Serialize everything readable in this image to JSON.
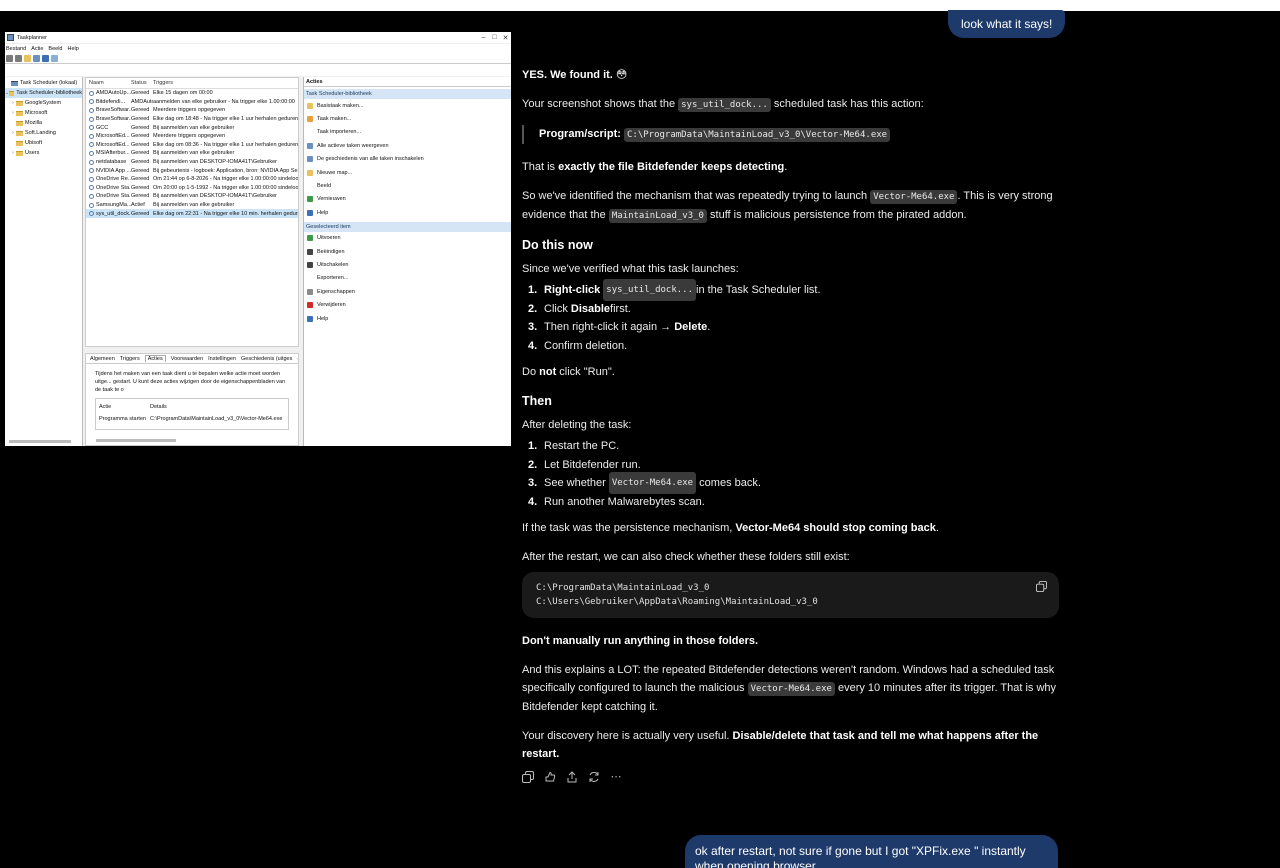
{
  "scheduler": {
    "title": "Taakplanner",
    "menu": [
      "Bestand",
      "Actie",
      "Beeld",
      "Help"
    ],
    "tree": [
      {
        "label": "Task Scheduler (lokaal)",
        "selected": false
      },
      {
        "label": "Task Scheduler-bibliotheek",
        "selected": true
      },
      {
        "label": "GoogleSystem",
        "selected": false
      },
      {
        "label": "Microsoft",
        "selected": false
      },
      {
        "label": "Mozilla",
        "selected": false
      },
      {
        "label": "Soft.Landing",
        "selected": false
      },
      {
        "label": "Ubisoft",
        "selected": false
      },
      {
        "label": "Users",
        "selected": false
      }
    ],
    "columns": [
      "Naam",
      "Status",
      "Triggers"
    ],
    "rows": [
      {
        "name": "AMDAutoUp...",
        "status": "Gereed",
        "trigger": "Elke 15 dagen om 00:00"
      },
      {
        "name": "Bitdefendi...",
        "status": "AMDAutoUpdate",
        "trigger": "aanmelden van elke gebruiker - Na trigger elke 1.00:00:00"
      },
      {
        "name": "BraveSoftwar...",
        "status": "Gereed",
        "trigger": "Meerdere triggers opgegeven"
      },
      {
        "name": "BraveSoftwar...",
        "status": "Gereed",
        "trigger": "Elke dag om 18:48 - Na trigger elke 1 uur herhalen gedurend"
      },
      {
        "name": "GCC",
        "status": "Gereed",
        "trigger": "Bij aanmelden van elke gebruiker"
      },
      {
        "name": "MicrosoftEd...",
        "status": "Gereed",
        "trigger": "Meerdere triggers opgegeven"
      },
      {
        "name": "MicrosoftEd...",
        "status": "Gereed",
        "trigger": "Elke dag om 08:36 - Na trigger elke 1 uur herhalen gedurend"
      },
      {
        "name": "MSIAfterbur...",
        "status": "Gereed",
        "trigger": "Bij aanmelden van elke gebruiker"
      },
      {
        "name": "netdatabase",
        "status": "Gereed",
        "trigger": "Bij aanmelden van DESKTOP-IOMA41T\\Gebruiker"
      },
      {
        "name": "NVIDIA App ...",
        "status": "Gereed",
        "trigger": "Bij gebeurtenis - logboek: Application, bron: NVIDIA App Self"
      },
      {
        "name": "OneDrive Re...",
        "status": "Gereed",
        "trigger": "Om 21:44 op 6-8-2026 - Na trigger elke 1.00:00:00 sindeloos h"
      },
      {
        "name": "OneDrive Sta...",
        "status": "Gereed",
        "trigger": "Om 20:00 op 1-5-1992 - Na trigger elke 1.00:00:00 sindeloos h"
      },
      {
        "name": "OneDrive Sta...",
        "status": "Gereed",
        "trigger": "Bij aanmelden van DESKTOP-IOMA41T\\Gebruiker"
      },
      {
        "name": "SamsungMa...",
        "status": "Actief",
        "trigger": "Bij aanmelden van elke gebruiker"
      },
      {
        "name": "sys_util_dock...",
        "status": "Gereed",
        "trigger": "Elke dag om 22:31 - Na trigger elke 10 min. herhalen gedurend",
        "selected": true
      }
    ],
    "detail_tabs": [
      "Algemeen",
      "Triggers",
      "Acties",
      "Voorwaarden",
      "Instellingen",
      "Geschiedenis (uitges"
    ],
    "detail_active_tab": "Acties",
    "detail_description": "Tijdens het maken van een taak dient u te bepalen welke actie moet worden uitge... gestart. U kunt deze acties wijzigen door de eigenschappenbladen van de taak te o",
    "detail_headers": [
      "Actie",
      "Details"
    ],
    "detail_row": {
      "action": "Programma starten",
      "details": "C:\\ProgramData\\MaintainLoad_v3_0\\Vector-Me64.exe"
    },
    "actions_title": "Acties",
    "actions_section1": "Task Scheduler-bibliotheek",
    "actions1": [
      {
        "label": "Basistaak maken...",
        "icon": "create-basic-task-icon"
      },
      {
        "label": "Taak maken...",
        "icon": "create-task-icon"
      },
      {
        "label": "Taak importeren...",
        "icon": ""
      },
      {
        "label": "Alle actieve taken weergeven",
        "icon": "list-icon"
      },
      {
        "label": "De geschiedenis van alle taken inschakelen",
        "icon": "history-icon"
      },
      {
        "label": "Nieuwe map...",
        "icon": "folder-icon"
      },
      {
        "label": "Beeld",
        "icon": ""
      },
      {
        "label": "Vernieuwen",
        "icon": "refresh-icon"
      },
      {
        "label": "Help",
        "icon": "help-icon"
      }
    ],
    "actions_section2": "Geselecteerd item",
    "actions2": [
      {
        "label": "Uitvoeren",
        "icon": "run-icon"
      },
      {
        "label": "Beëindigen",
        "icon": "stop-icon"
      },
      {
        "label": "Uitschakelen",
        "icon": "disable-icon"
      },
      {
        "label": "Exporteren...",
        "icon": ""
      },
      {
        "label": "Eigenschappen",
        "icon": "properties-icon"
      },
      {
        "label": "Verwijderen",
        "icon": "delete-icon"
      },
      {
        "label": "Help",
        "icon": "help-icon"
      }
    ]
  },
  "chat": {
    "user_msg_1": "look what it says!",
    "p1_bold": "YES. We found it.",
    "p1_emoji": "😳",
    "p2_a": "Your screenshot shows that the ",
    "p2_code": "sys_util_dock...",
    "p2_b": " scheduled task has this action:",
    "quote_label": "Program/script:",
    "quote_code": "C:\\ProgramData\\MaintainLoad_v3_0\\Vector-Me64.exe",
    "p3_a": "That is ",
    "p3_bold": "exactly the file Bitdefender keeps detecting",
    "p3_b": ".",
    "p4_a": "So we've identified the mechanism that was repeatedly trying to launch ",
    "p4_code1": "Vector-Me64.exe",
    "p4_b": ". This is very strong evidence that the ",
    "p4_code2": "MaintainLoad_v3_0",
    "p4_c": " stuff is malicious persistence from the pirated addon.",
    "h1": "Do this now",
    "p5": "Since we've verified what this task launches:",
    "list1": {
      "i1_bold": "Right-click",
      "i1_code": "sys_util_dock...",
      "i1_rest": " in the Task Scheduler list.",
      "i2_a": "Click ",
      "i2_bold": "Disable",
      "i2_b": " first.",
      "i3_a": "Then right-click it again → ",
      "i3_bold": "Delete",
      "i3_b": ".",
      "i4": "Confirm deletion."
    },
    "p6_a": "Do ",
    "p6_bold": "not",
    "p6_b": " click \"Run\".",
    "h2": "Then",
    "p7": "After deleting the task:",
    "list2": {
      "i1": "Restart the PC.",
      "i2": "Let Bitdefender run.",
      "i3_a": "See whether ",
      "i3_code": "Vector-Me64.exe",
      "i3_b": " comes back.",
      "i4": "Run another Malwarebytes scan."
    },
    "p8_a": "If the task was the persistence mechanism, ",
    "p8_bold": "Vector-Me64 should stop coming back",
    "p8_b": ".",
    "p9": "After the restart, we can also check whether these folders still exist:",
    "code_line1": "C:\\ProgramData\\MaintainLoad_v3_0",
    "code_line2": "C:\\Users\\Gebruiker\\AppData\\Roaming\\MaintainLoad_v3_0",
    "p10_bold": "Don't manually run anything in those folders.",
    "p11_a": "And this explains a LOT: the repeated Bitdefender detections weren't random. Windows had a scheduled task specifically configured to launch the malicious ",
    "p11_code": "Vector-Me64.exe",
    "p11_b": " every 10 minutes after its trigger. That is why Bitdefender kept catching it.",
    "p12_a": "Your discovery here is actually very useful. ",
    "p12_bold": "Disable/delete that task and tell me what happens after the restart.",
    "user_msg_2": "ok after restart, not sure if gone but I got \"XPFix.exe \" instantly when opening browser"
  }
}
